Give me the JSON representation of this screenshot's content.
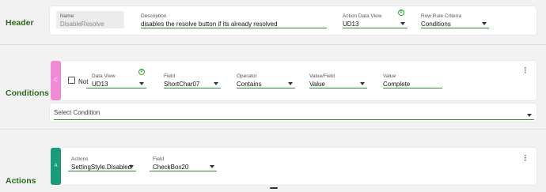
{
  "sections": {
    "header": "Header",
    "conditions": "Conditions",
    "actions": "Actions"
  },
  "header": {
    "name_label": "Name",
    "name_value": "DisableResolve",
    "description_label": "Description",
    "description_value": "disables the resolve button if its already resolved",
    "action_data_view_label": "Action Data View",
    "action_data_view_value": "UD13",
    "row_rule_criteria_label": "Row Rule Criteria",
    "row_rule_criteria_value": "Conditions",
    "badge": "P"
  },
  "condition": {
    "tab": "C",
    "not_label": "Not",
    "data_view_label": "Data View",
    "data_view_value": "UD13",
    "badge": "P",
    "field_label": "Field",
    "field_value": "ShortChar07",
    "operator_label": "Operator",
    "operator_value": "Contains",
    "value_field_label": "Value/Field",
    "value_field_value": "Value",
    "value_label": "Value",
    "value_value": "Complete",
    "select_condition_placeholder": "Select Condition"
  },
  "action": {
    "tab": "A",
    "actions_label": "Actions",
    "actions_value": "SettingStyle.Disabled",
    "field_label": "Field",
    "field_value": "CheckBox20"
  },
  "colors": {
    "accent_green": "#2e8b3a",
    "section_label": "#2e6b1f",
    "condition_tab": "#f08ad6",
    "action_tab": "#1a9a78"
  },
  "icons": [
    "chevron-down-icon",
    "kebab-menu-icon",
    "checkbox-icon",
    "info-badge-icon"
  ]
}
